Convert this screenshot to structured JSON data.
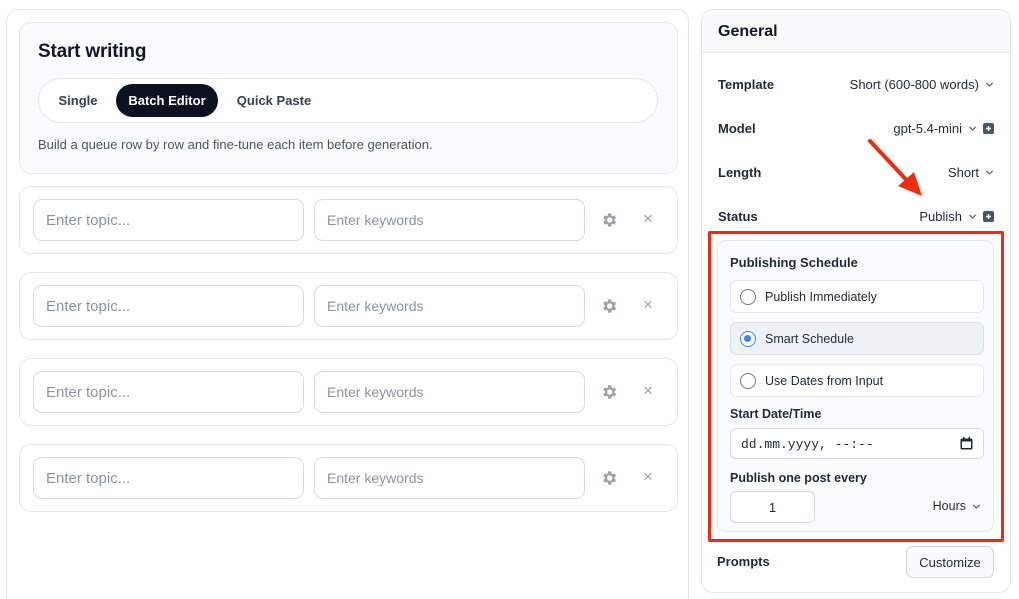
{
  "start": {
    "title": "Start writing",
    "tabs": [
      {
        "label": "Single",
        "active": false
      },
      {
        "label": "Batch Editor",
        "active": true
      },
      {
        "label": "Quick Paste",
        "active": false
      }
    ],
    "description": "Build a queue row by row and fine-tune each item before generation."
  },
  "queue": {
    "topic_placeholder": "Enter topic...",
    "keywords_placeholder": "Enter keywords",
    "settings_icon": "gear-icon",
    "remove_label": "×"
  },
  "general": {
    "title": "General",
    "template": {
      "label": "Template",
      "value": "Short (600-800 words)"
    },
    "model": {
      "label": "Model",
      "value": "gpt-5.4-mini"
    },
    "length": {
      "label": "Length",
      "value": "Short"
    },
    "status": {
      "label": "Status",
      "value": "Publish"
    }
  },
  "schedule": {
    "title": "Publishing Schedule",
    "options": [
      {
        "label": "Publish Immediately",
        "selected": false
      },
      {
        "label": "Smart Schedule",
        "selected": true
      },
      {
        "label": "Use Dates from Input",
        "selected": false
      }
    ],
    "start_label": "Start Date/Time",
    "start_value": "dd.mm.yyyy, --:--",
    "interval_label": "Publish one post every",
    "interval_value": "1",
    "interval_unit": "Hours"
  },
  "prompts": {
    "label": "Prompts",
    "button": "Customize"
  },
  "colors": {
    "annotation": "#ef2b0f",
    "accent": "#3b82f6",
    "active_tab": "#0b1120"
  }
}
